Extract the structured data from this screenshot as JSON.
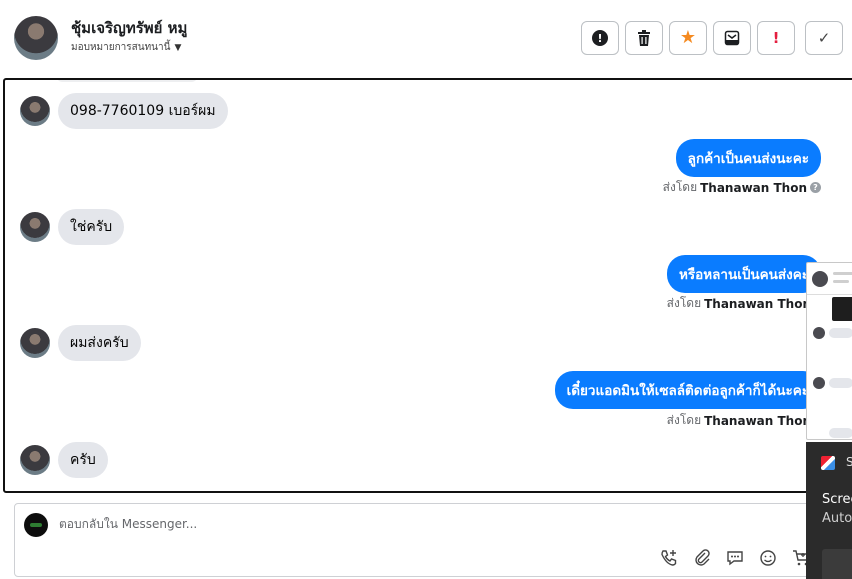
{
  "header": {
    "contact_name": "ชุ้มเจริญทรัพย์ หมู",
    "assign_label": "มอบหมายการสนทนานี้",
    "actions": [
      {
        "icon": "alert-circle-icon"
      },
      {
        "icon": "trash-icon"
      },
      {
        "icon": "star-icon"
      },
      {
        "icon": "inbox-icon"
      },
      {
        "icon": "exclamation-icon"
      },
      {
        "icon": "check-icon"
      }
    ]
  },
  "conversation": {
    "incoming": [
      {
        "text": "098-7760109 เบอร์ผม"
      },
      {
        "text": "ใช่ครับ"
      },
      {
        "text": "ผมส่งครับ"
      },
      {
        "text": "ครับ"
      }
    ],
    "outgoing": [
      {
        "text": "ลูกค้าเป็นคนส่งนะคะ",
        "sent_by_prefix": "ส่งโดย",
        "sender": "Thanawan Thon"
      },
      {
        "text": "หรือหลานเป็นคนส่งคะ",
        "sent_by_prefix": "ส่งโดย",
        "sender": "Thanawan Thon"
      },
      {
        "text": "เดี๋ยวแอดมินให้เซลล์ติดต่อลูกค้าก็ได้นะคะ",
        "sent_by_prefix": "ส่งโดย",
        "sender": "Thanawan Thon"
      }
    ]
  },
  "composer": {
    "placeholder": "ตอบกลับใน Messenger...",
    "tools": [
      "phone-add-icon",
      "attachment-icon",
      "saved-reply-icon",
      "emoji-icon",
      "cart-icon"
    ]
  },
  "overlay": {
    "toast_app": "S",
    "toast_title": "Scree",
    "toast_subtitle": "Auto"
  },
  "colors": {
    "outgoing_bubble": "#0a7cff",
    "incoming_bubble": "#e4e6eb",
    "star": "#f58a20",
    "exclamation": "#e41e3f"
  }
}
